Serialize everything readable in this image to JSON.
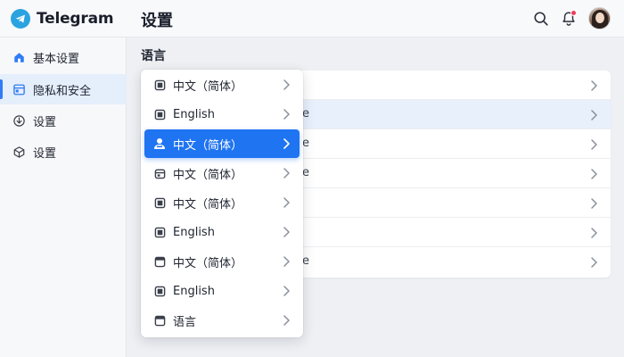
{
  "app": {
    "brand_name": "Telegram",
    "page_title": "设置"
  },
  "colors": {
    "accent": "#1f74f2",
    "brand": "#2aa3e0",
    "notification_badge": "#ef3b5c",
    "active_nav_bg": "#e5eefb"
  },
  "topbar": {
    "icons": [
      "search-icon",
      "bell-icon",
      "avatar"
    ],
    "notification_dot": true
  },
  "sidebar": {
    "items": [
      {
        "label": "基本设置",
        "icon": "home-icon",
        "active": false
      },
      {
        "label": "隐私和安全",
        "icon": "window-icon",
        "active": true
      },
      {
        "label": "设置",
        "icon": "shield-download-icon",
        "active": false
      },
      {
        "label": "设置",
        "icon": "cube-icon",
        "active": false
      }
    ]
  },
  "main": {
    "section_title": "语言",
    "rows": [
      {
        "tail": ""
      },
      {
        "tail": "e",
        "highlight": true
      },
      {
        "tail": "e"
      },
      {
        "tail": "e"
      },
      {
        "tail": ""
      },
      {
        "tail": ""
      },
      {
        "tail": "e"
      }
    ]
  },
  "dropdown": {
    "items": [
      {
        "label": "中文（简体）",
        "icon": "square-icon",
        "selected": false
      },
      {
        "label": "English",
        "icon": "square-icon",
        "selected": false
      },
      {
        "label": "中文（简体）",
        "icon": "user-group-icon",
        "selected": true
      },
      {
        "label": "中文（简体）",
        "icon": "calendar-icon",
        "selected": false
      },
      {
        "label": "中文（简体）",
        "icon": "square-icon",
        "selected": false
      },
      {
        "label": "English",
        "icon": "square-icon",
        "selected": false
      },
      {
        "label": "中文（简体）",
        "icon": "window-icon",
        "selected": false
      },
      {
        "label": "English",
        "icon": "square-icon",
        "selected": false
      },
      {
        "label": "语言",
        "icon": "window-icon",
        "selected": false
      }
    ]
  }
}
